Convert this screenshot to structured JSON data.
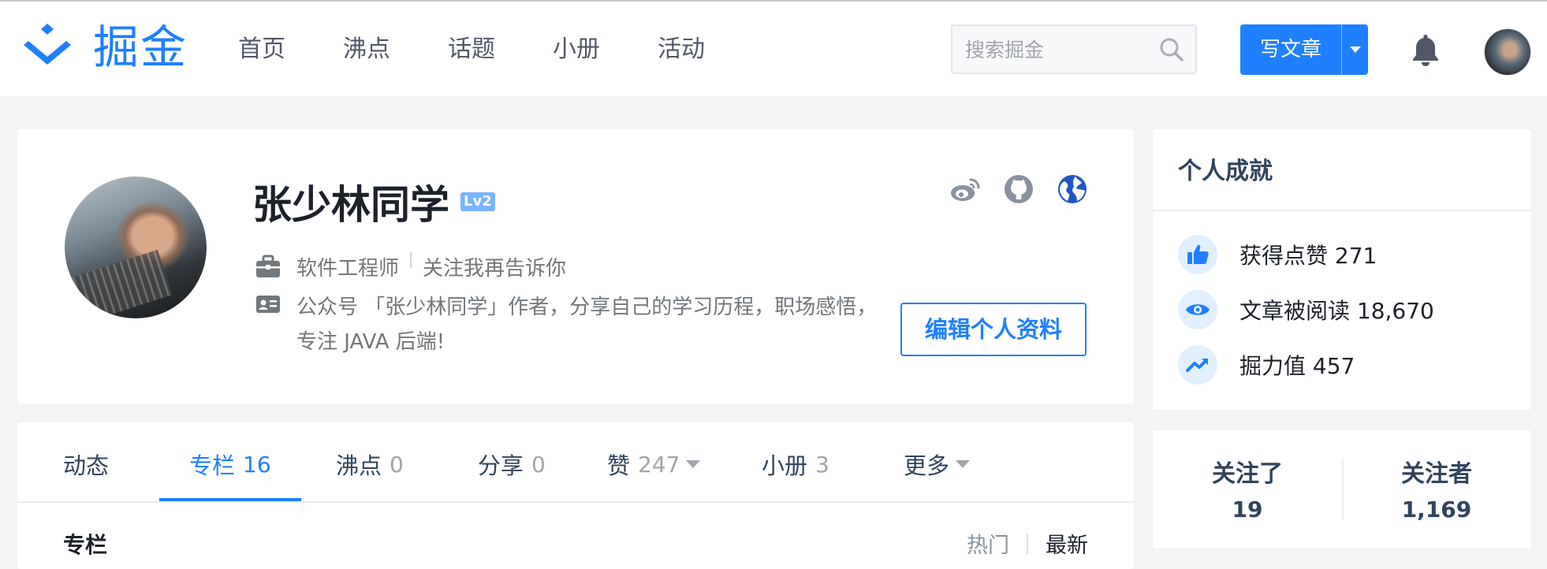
{
  "brand": {
    "name": "掘金",
    "color": "#1e80ff"
  },
  "nav": {
    "items": [
      "首页",
      "沸点",
      "话题",
      "小册",
      "活动"
    ]
  },
  "search": {
    "placeholder": "搜索掘金"
  },
  "header": {
    "write_label": "写文章"
  },
  "icons": {
    "logo": "juejin-logo-icon",
    "search": "search-icon",
    "write_dropdown": "caret-down-icon",
    "bell": "bell-icon",
    "weibo": "weibo-icon",
    "github": "github-icon",
    "website": "globe-icon",
    "job": "briefcase-icon",
    "bio": "id-card-icon",
    "likes": "thumbs-up-icon",
    "reads": "eye-icon",
    "power": "trend-up-icon"
  },
  "profile": {
    "name": "张少林同学",
    "level": "Lv2",
    "job_title": "软件工程师",
    "company": "关注我再告诉你",
    "bio": "公众号 「张少林同学」作者，分享自己的学习历程，职场感悟，专注 JAVA 后端!",
    "edit_label": "编辑个人资料"
  },
  "tabs": [
    {
      "label": "动态",
      "count": ""
    },
    {
      "label": "专栏",
      "count": "16"
    },
    {
      "label": "沸点",
      "count": "0"
    },
    {
      "label": "分享",
      "count": "0"
    },
    {
      "label": "赞",
      "count": "247"
    },
    {
      "label": "小册",
      "count": "3"
    },
    {
      "label": "更多",
      "count": ""
    }
  ],
  "section": {
    "title": "专栏",
    "sort_hot": "热门",
    "sort_new": "最新"
  },
  "achievements": {
    "title": "个人成就",
    "likes": "获得点赞 271",
    "reads": "文章被阅读 18,670",
    "power": "掘力值 457"
  },
  "follow": {
    "following_label": "关注了",
    "following_count": "19",
    "followers_label": "关注者",
    "followers_count": "1,169"
  }
}
